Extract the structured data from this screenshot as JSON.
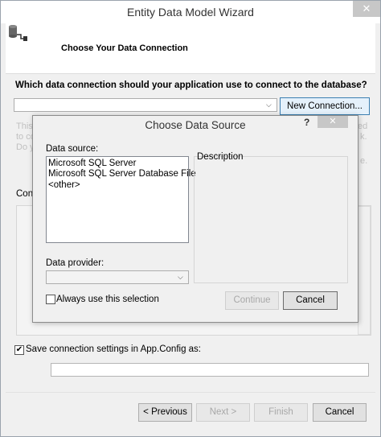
{
  "wizard": {
    "title": "Entity Data Model Wizard",
    "close_glyph": "✕",
    "heading": "Choose Your Data Connection",
    "question": "Which data connection should your application use to connect to the database?",
    "connection_value": "",
    "new_connection_label": "New Connection...",
    "faded_left_lines": [
      "This",
      "to co",
      "Do y"
    ],
    "faded_right_lines": [
      "ed",
      "k.",
      "e."
    ],
    "connection_string_label": "Conn",
    "save_settings_label": "Save connection settings in App.Config as:",
    "save_settings_checked": true,
    "config_name_value": "",
    "footer": {
      "previous": "< Previous",
      "next": "Next >",
      "finish": "Finish",
      "cancel": "Cancel"
    }
  },
  "dialog": {
    "title": "Choose Data Source",
    "help_glyph": "?",
    "close_glyph": "✕",
    "data_source_label": "Data source:",
    "data_sources": [
      "Microsoft SQL Server",
      "Microsoft SQL Server Database File",
      "<other>"
    ],
    "description_label": "Description",
    "data_provider_label": "Data provider:",
    "data_provider_value": "",
    "always_use_label": "Always use this selection",
    "always_use_checked": false,
    "continue_label": "Continue",
    "cancel_label": "Cancel"
  },
  "icons": {
    "header_icon": "database-connection-icon",
    "dropdown": "chevron-down-icon",
    "check": "checkmark-icon"
  },
  "colors": {
    "accent_button_border": "#3c7fb1",
    "accent_button_fill": "#e5f1fb",
    "window_bg": "#f0f0f0",
    "close_button": "#c7c7c7"
  }
}
